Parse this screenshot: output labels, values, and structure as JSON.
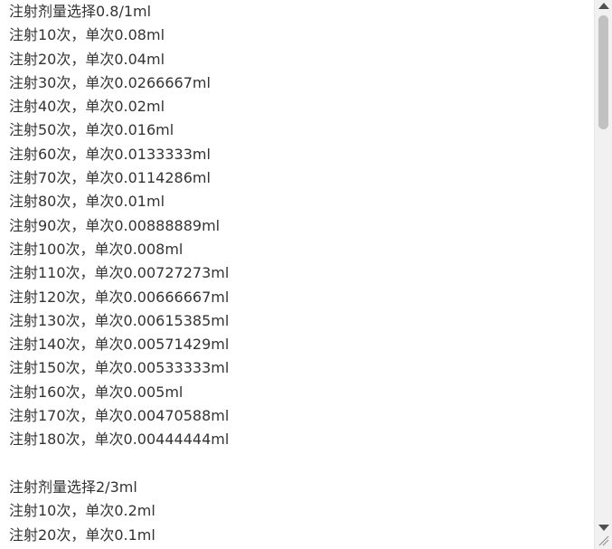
{
  "textarea": {
    "lines": [
      "注射剂量选择0.8/1ml",
      "注射10次，单次0.08ml",
      "注射20次，单次0.04ml",
      "注射30次，单次0.0266667ml",
      "注射40次，单次0.02ml",
      "注射50次，单次0.016ml",
      "注射60次，单次0.0133333ml",
      "注射70次，单次0.0114286ml",
      "注射80次，单次0.01ml",
      "注射90次，单次0.00888889ml",
      "注射100次，单次0.008ml",
      "注射110次，单次0.00727273ml",
      "注射120次，单次0.00666667ml",
      "注射130次，单次0.00615385ml",
      "注射140次，单次0.00571429ml",
      "注射150次，单次0.00533333ml",
      "注射160次，单次0.005ml",
      "注射170次，单次0.00470588ml",
      "注射180次，单次0.00444444ml",
      "",
      "注射剂量选择2/3ml",
      "注射10次，单次0.2ml",
      "注射20次，单次0.1ml"
    ]
  },
  "scrollbar": {
    "up_icon": "chevron-up-icon",
    "down_icon": "chevron-down-icon",
    "resize_icon": "resize-grip-icon"
  }
}
